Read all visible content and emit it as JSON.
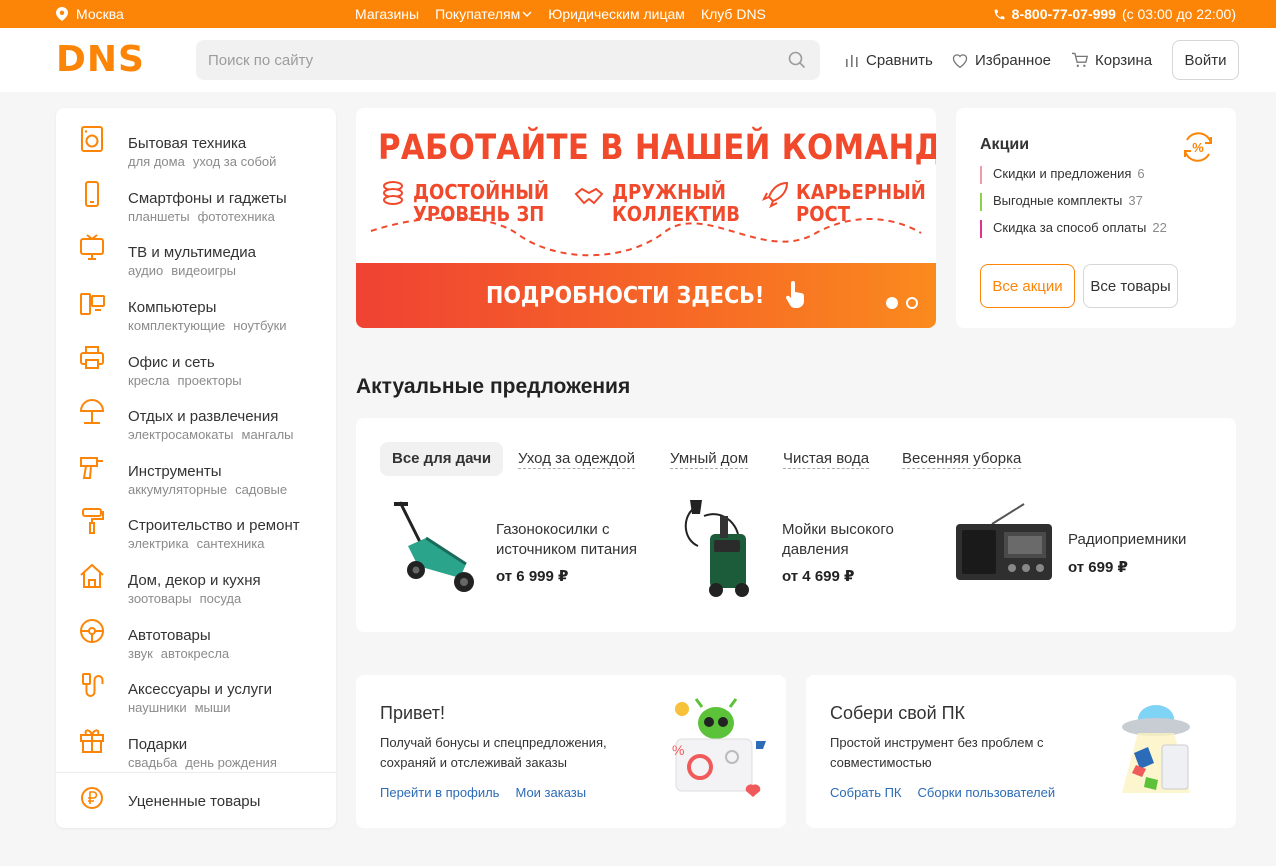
{
  "topbar": {
    "city": "Москва",
    "links": [
      "Магазины",
      "Покупателям",
      "Юридическим лицам",
      "Клуб DNS"
    ],
    "phone": "8-800-77-07-999",
    "hours": "(с 03:00 до 22:00)"
  },
  "header": {
    "logo": "DNS",
    "search_placeholder": "Поиск по сайту",
    "compare": "Сравнить",
    "favorites": "Избранное",
    "cart": "Корзина",
    "login": "Войти"
  },
  "catalog": [
    {
      "title": "Бытовая техника",
      "subs": [
        "для дома",
        "уход за собой"
      ],
      "icon": "washing-machine-icon"
    },
    {
      "title": "Смартфоны и гаджеты",
      "subs": [
        "планшеты",
        "фототехника"
      ],
      "icon": "smartphone-icon"
    },
    {
      "title": "ТВ и мультимедиа",
      "subs": [
        "аудио",
        "видеоигры"
      ],
      "icon": "tv-icon"
    },
    {
      "title": "Компьютеры",
      "subs": [
        "комплектующие",
        "ноутбуки"
      ],
      "icon": "computer-icon"
    },
    {
      "title": "Офис и сеть",
      "subs": [
        "кресла",
        "проекторы"
      ],
      "icon": "printer-icon"
    },
    {
      "title": "Отдых и развлечения",
      "subs": [
        "электросамокаты",
        "мангалы"
      ],
      "icon": "umbrella-icon"
    },
    {
      "title": "Инструменты",
      "subs": [
        "аккумуляторные",
        "садовые"
      ],
      "icon": "drill-icon"
    },
    {
      "title": "Строительство и ремонт",
      "subs": [
        "электрика",
        "сантехника"
      ],
      "icon": "paint-roller-icon"
    },
    {
      "title": "Дом, декор и кухня",
      "subs": [
        "зоотовары",
        "посуда"
      ],
      "icon": "house-icon"
    },
    {
      "title": "Автотовары",
      "subs": [
        "звук",
        "автокресла"
      ],
      "icon": "steering-wheel-icon"
    },
    {
      "title": "Аксессуары и услуги",
      "subs": [
        "наушники",
        "мыши"
      ],
      "icon": "cable-icon"
    },
    {
      "title": "Подарки",
      "subs": [
        "свадьба",
        "день рождения"
      ],
      "icon": "gift-icon"
    }
  ],
  "discounted": "Уцененные товары",
  "banner": {
    "title": "РАБОТАЙТЕ В НАШЕЙ КОМАНДЕ!",
    "f1": [
      "ДОСТОЙНЫЙ",
      "УРОВЕНЬ ЗП"
    ],
    "f2": [
      "ДРУЖНЫЙ",
      "КОЛЛЕКТИВ"
    ],
    "f3": [
      "КАРЬЕРНЫЙ",
      "РОСТ"
    ],
    "cta": "ПОДРОБНОСТИ ЗДЕСЬ!"
  },
  "promo": {
    "title": "Акции",
    "items": [
      {
        "label": "Скидки и предложения",
        "count": "6",
        "color": "#f19aa8"
      },
      {
        "label": "Выгодные комплекты",
        "count": "37",
        "color": "#8fd04a"
      },
      {
        "label": "Скидка за способ оплаты",
        "count": "22",
        "color": "#e0338e"
      }
    ],
    "all_promos": "Все акции",
    "all_goods": "Все товары"
  },
  "offers": {
    "title": "Актуальные предложения",
    "tabs": [
      "Все для дачи",
      "Уход за одеждой",
      "Умный дом",
      "Чистая вода",
      "Весенняя уборка"
    ],
    "products": [
      {
        "name": "Газонокосилки с источником питания",
        "price": "от 6 999 ₽"
      },
      {
        "name": "Мойки высокого давления",
        "price": "от 4 699 ₽"
      },
      {
        "name": "Радиоприемники",
        "price": "от 699 ₽"
      }
    ]
  },
  "cards": {
    "profile": {
      "title": "Привет!",
      "desc": "Получай бонусы и спецпредложения, сохраняй и отслеживай заказы",
      "links": [
        "Перейти в профиль",
        "Мои заказы"
      ]
    },
    "pc": {
      "title": "Собери свой ПК",
      "desc": "Простой инструмент без проблем с совместимостью",
      "links": [
        "Собрать ПК",
        "Сборки пользователей"
      ]
    }
  },
  "colors": {
    "brand": "#fc8507",
    "banner_red": "#f0492b",
    "link": "#2c6bb7"
  }
}
